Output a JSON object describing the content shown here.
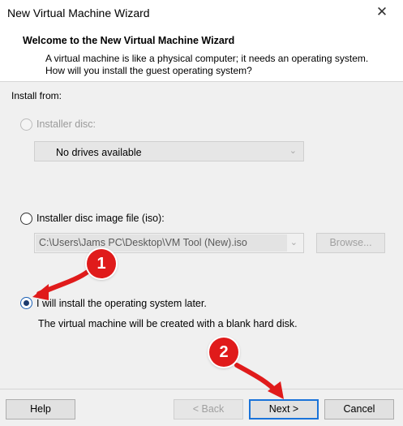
{
  "window": {
    "title": "New Virtual Machine Wizard"
  },
  "header": {
    "title": "Welcome to the New Virtual Machine Wizard",
    "description": "A virtual machine is like a physical computer; it needs an operating system. How will you install the guest operating system?"
  },
  "install_from_label": "Install from:",
  "options": {
    "installer_disc": {
      "label": "Installer disc:",
      "combo_value": "No drives available"
    },
    "iso": {
      "label": "Installer disc image file (iso):",
      "path": "C:\\Users\\Jams PC\\Desktop\\VM Tool (New).iso",
      "browse_label": "Browse..."
    },
    "later": {
      "label": "I will install the operating system later.",
      "note": "The virtual machine will be created with a blank hard disk."
    }
  },
  "buttons": {
    "help": "Help",
    "back": "< Back",
    "next": "Next >",
    "cancel": "Cancel"
  },
  "annotations": {
    "badge1": "1",
    "badge2": "2",
    "color": "#e01b1b"
  }
}
